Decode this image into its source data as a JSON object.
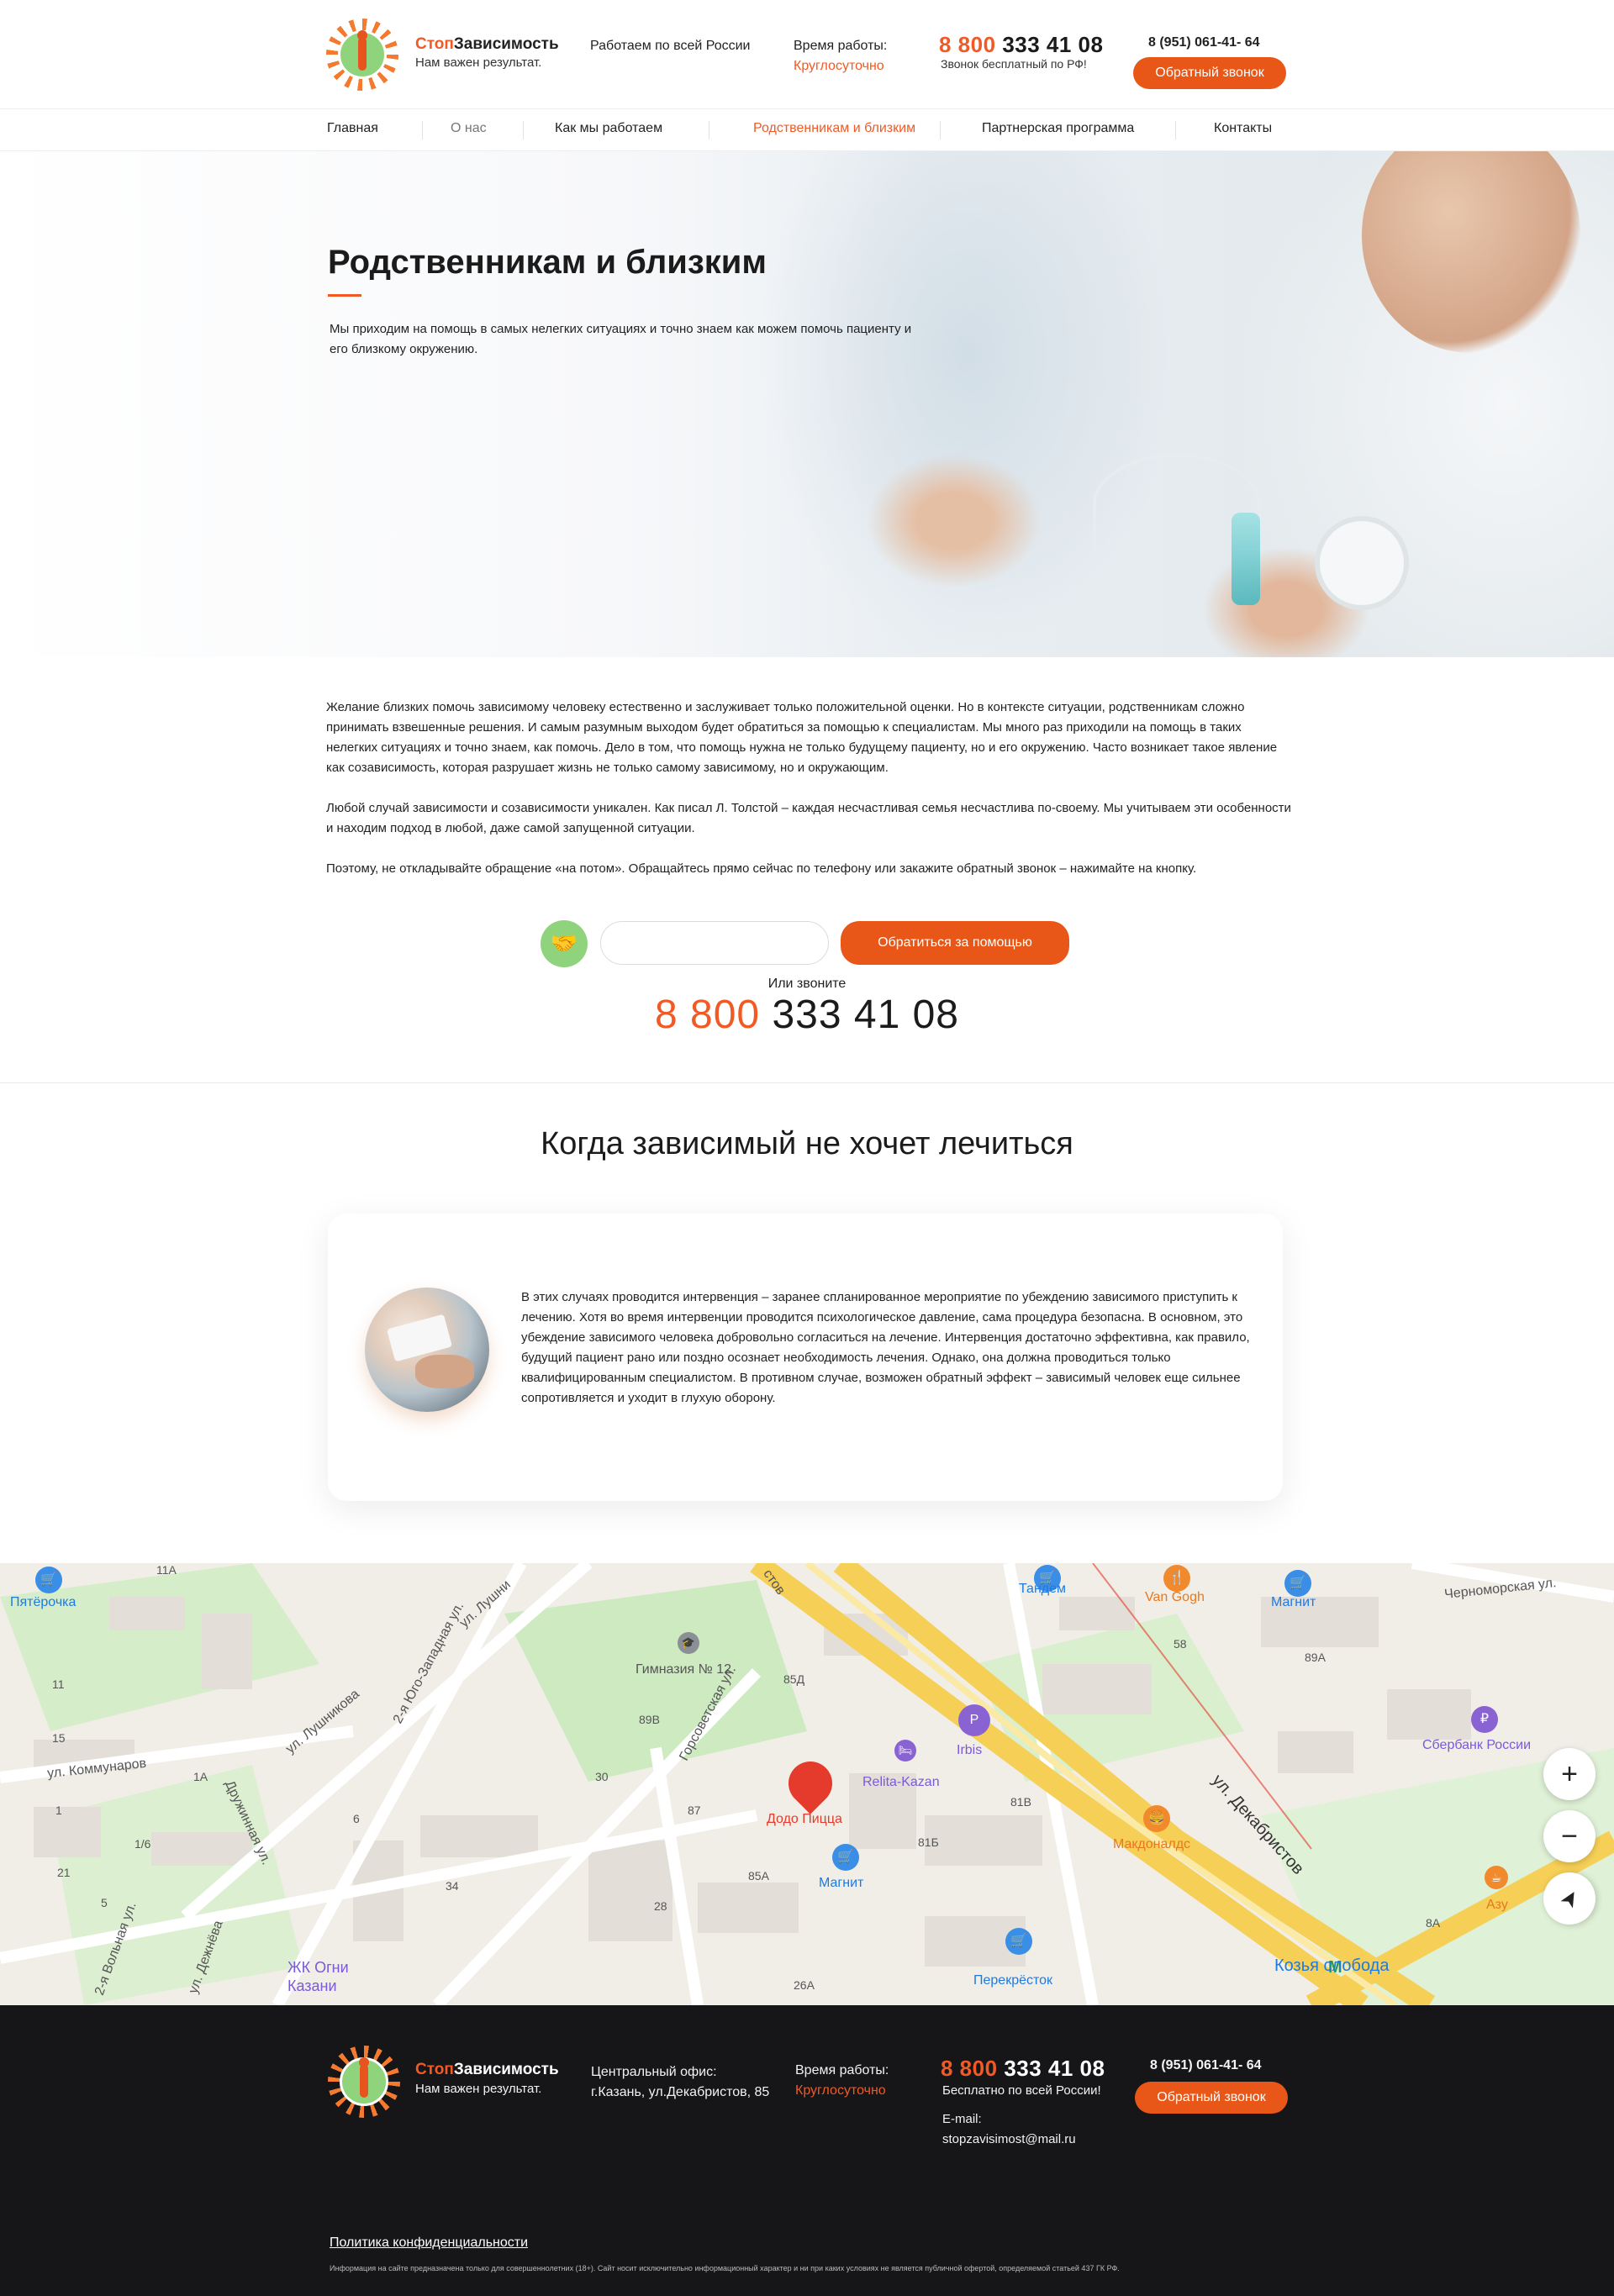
{
  "header": {
    "brand_part1": "Стоп",
    "brand_part2": "Зависимость",
    "tagline": "Нам важен результат.",
    "region": "Работаем по всей России",
    "hours_label": "Время работы:",
    "hours_value": "Круглосуточно",
    "phone_part1": "8 800",
    "phone_part2": "333 41 08",
    "phone_note": "Звонок бесплатный по РФ!",
    "phone_secondary": "8 (951) 061-41- 64",
    "callback_label": "Обратный звонок"
  },
  "nav": {
    "items": [
      {
        "label": "Главная"
      },
      {
        "label": "О нас"
      },
      {
        "label": "Как мы работаем"
      },
      {
        "label": "Родственникам и близким"
      },
      {
        "label": "Партнерская программа"
      },
      {
        "label": "Контакты"
      }
    ]
  },
  "hero": {
    "title": "Родственникам и близким",
    "subtitle": "Мы приходим на помощь в самых нелегких ситуациях и точно знаем как можем помочь пациенту и его  близкому окружению."
  },
  "body": {
    "paragraphs": [
      "Желание близких помочь зависимому человеку естественно и заслуживает только положительной оценки. Но в контексте ситуации, родственникам сложно принимать взвешенные решения. И самым разумным выходом будет обратиться за помощью к специалистам. Мы много раз приходили на помощь в таких нелегких ситуациях и точно знаем, как помочь. Дело в том, что помощь нужна не только будущему пациенту, но и его окружению. Часто возникает такое явление как созависимость, которая разрушает жизнь  не только самому зависимому, но и окружающим.",
      "Любой случай зависимости и созависимости уникален. Как писал Л. Толстой –  каждая несчастливая семья несчастлива по-своему. Мы учитываем эти особенности и находим подход в любой, даже самой запущенной ситуации.",
      "Поэтому, не откладывайте обращение «на потом». Обращайтесь прямо сейчас по телефону или закажите обратный звонок – нажимайте на кнопку."
    ]
  },
  "form": {
    "phone_value": "",
    "submit_label": "Обратиться за помощью",
    "or_call": "Или звоните",
    "phone_part1": "8 800",
    "phone_part2": "333 41 08"
  },
  "section2": {
    "title": "Когда зависимый не хочет лечиться",
    "text": "В этих случаях проводится интервенция – заранее спланированное мероприятие по убеждению зависимого приступить к лечению. Хотя во время интервенции проводится психологическое давление, сама процедура безопасна. В основном, это убеждение зависимого человека добровольно согласиться на лечение. Интервенция достаточно эффективна, как правило, будущий пациент рано или поздно осознает необходимость лечения. Однако, она должна проводиться только квалифицированным специалистом. В противном случае, возможен обратный эффект – зависимый человек еще сильнее сопротивляется и уходит в глухую оборону."
  },
  "map": {
    "streets": [
      "ул. Коммунаров",
      "ул. Лушникова",
      "2-я Юго-Западная ул.",
      "Горсоветская ул.",
      "Дружинная ул.",
      "ул. Декабристов",
      "Черноморская ул.",
      "2-я Вольная ул.",
      "ул. Дежнёва",
      "ул. Лушни"
    ],
    "street_cut": "стов",
    "places": {
      "pyaterochka": "Пятёрочка",
      "gymnasium": "Гимназия № 12",
      "tandem": "Тандем",
      "vangogh": "Van Gogh",
      "magnit1": "Магнит",
      "magnit2": "Магнит",
      "irbis": "Irbis",
      "relita": "Relita-Kazan",
      "dodo": "Додо Пицца",
      "mcd": "Макдоналдс",
      "sber": "Сбербанк России",
      "azu": "Азу",
      "perekrestok": "Перекрёсток",
      "kozya": "Козья слобода",
      "zhk": "ЖК Огни Казани"
    },
    "house_numbers": [
      "11А",
      "11",
      "1А",
      "1/6",
      "1",
      "5",
      "34",
      "30",
      "87",
      "85А",
      "28",
      "26А",
      "89В",
      "85Д",
      "81В",
      "81Б",
      "89А",
      "58",
      "8А",
      "1",
      "15",
      "21",
      "6"
    ],
    "zoom_in": "+",
    "zoom_out": "−",
    "locate": "➤"
  },
  "footer": {
    "brand_part1": "Стоп",
    "brand_part2": "Зависимость",
    "tagline": "Нам важен результат.",
    "office_label": "Центральный офис:",
    "office_address": "г.Казань, ул.Декабристов, 85",
    "hours_label": "Время работы:",
    "hours_value": "Круглосуточно",
    "phone_part1": "8 800",
    "phone_part2": "333 41 08",
    "phone_note": "Бесплатно по всей России!",
    "email_label": "E-mail:",
    "email": "stopzavisimost@mail.ru",
    "phone_secondary": "8 (951) 061-41- 64",
    "callback_label": "Обратный звонок",
    "policy": "Политика конфиденциальности",
    "disclaimer": "Информация на сайте предназначена только для совершеннолетних (18+). Сайт носит исключительно информационный характер и ни при каких условиях не является публичной офертой, определяемой статьей 437 ГК РФ."
  },
  "colors": {
    "accent": "#f15a24",
    "button": "#e95718",
    "logo_green": "#8fd37d",
    "footer_bg": "#161517"
  }
}
